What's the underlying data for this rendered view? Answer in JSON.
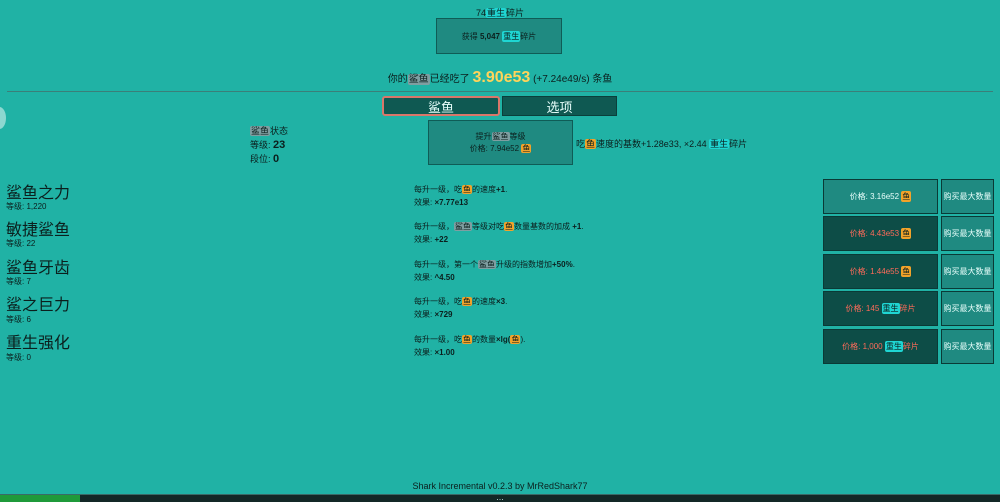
{
  "header": {
    "shards_amount": "74",
    "shards_tag": "重生",
    "shards_suffix": "碎片",
    "rebirth_button": {
      "prefix": "获得",
      "amount": "5,047",
      "tag": "重生",
      "suffix": "碎片"
    },
    "fish_line": {
      "prefix": "你的",
      "shark_tag": "鲨鱼",
      "mid": "已经吃了",
      "amount": "3.90e53",
      "rate": "(+7.24e49/s)",
      "suffix": "条鱼"
    }
  },
  "tabs": [
    {
      "label": "鲨鱼",
      "active": true
    },
    {
      "label": "选项",
      "active": false
    }
  ],
  "shark_status": {
    "title_tag": "鲨鱼",
    "title_suffix": "状态",
    "level_label": "等级:",
    "level_value": "23",
    "tier_label": "段位:",
    "tier_value": "0"
  },
  "level_up": {
    "line1_prefix": "提升",
    "line1_tag": "鲨鱼",
    "line1_suffix": "等级",
    "price_label": "价格:",
    "price_value": "7.94e52",
    "price_tag": "鱼",
    "desc_prefix": "吃",
    "desc_tag": "鱼",
    "desc_mid": "速度的基数+1.28e33, ×2.44",
    "desc_tag2": "重生",
    "desc_suffix": "碎片"
  },
  "upgrades": [
    {
      "name": "鲨鱼之力",
      "level": "等级: 1,220",
      "desc_pre": "每升一级，吃",
      "desc_tag": "鱼",
      "desc_post": "的速度",
      "desc_bold": "+1",
      "desc_end": ".",
      "effect_label": "效果: ",
      "effect_value": "×7.77e13",
      "price_text": "价格: 3.16e52",
      "price_tag": "鱼",
      "affordable": true,
      "max_label": "购买最大数量"
    },
    {
      "name": "敏捷鲨鱼",
      "level": "等级: 22",
      "desc_pre": "每升一级，",
      "desc_tag": "鲨鱼",
      "desc_post": "等级对吃",
      "desc_tag2": "鱼",
      "desc_post2": "数量基数的加成 ",
      "desc_bold": "+1",
      "desc_end": ".",
      "effect_label": "效果: ",
      "effect_value": "+22",
      "price_text": "价格: 4.43e53",
      "price_tag": "鱼",
      "affordable": false,
      "max_label": "购买最大数量"
    },
    {
      "name": "鲨鱼牙齿",
      "level": "等级: 7",
      "desc_pre": "每升一级，第一个",
      "desc_tag": "鲨鱼",
      "desc_post": "升级的指数增加",
      "desc_bold": "+50%",
      "desc_end": ".",
      "effect_label": "效果: ",
      "effect_value": "^4.50",
      "price_text": "价格: 1.44e55",
      "price_tag": "鱼",
      "affordable": false,
      "max_label": "购买最大数量"
    },
    {
      "name": "鲨之巨力",
      "level": "等级: 6",
      "desc_pre": "每升一级，吃",
      "desc_tag": "鱼",
      "desc_post": "的速度",
      "desc_bold": "×3",
      "desc_end": ".",
      "effect_label": "效果: ",
      "effect_value": "×729",
      "price_text": "价格: 145",
      "price_tag": "重生",
      "price_suffix": "碎片",
      "affordable": false,
      "max_label": "购买最大数量"
    },
    {
      "name": "重生强化",
      "level": "等级: 0",
      "desc_pre": "每升一级，吃",
      "desc_tag": "鱼",
      "desc_post": "的数量",
      "desc_bold": "×lg(",
      "desc_tag2": "鱼",
      "desc_end": ").",
      "effect_label": "效果: ",
      "effect_value": "×1.00",
      "price_text": "价格: 1,000",
      "price_tag": "重生",
      "price_suffix": "碎片",
      "affordable": false,
      "max_label": "购买最大数量"
    }
  ],
  "footer": {
    "credit": "Shark Incremental v0.2.3 by MrRedShark77",
    "progress_text": "…",
    "progress_fraction": 0.08
  },
  "colors": {
    "background": "#20b2a5",
    "button": "#1f8a81",
    "button_dark": "#0d4d47",
    "fish_amount": "#ffd45a",
    "unaffordable_text": "#ff6b5a",
    "progress_fill": "#1f9a3a"
  }
}
